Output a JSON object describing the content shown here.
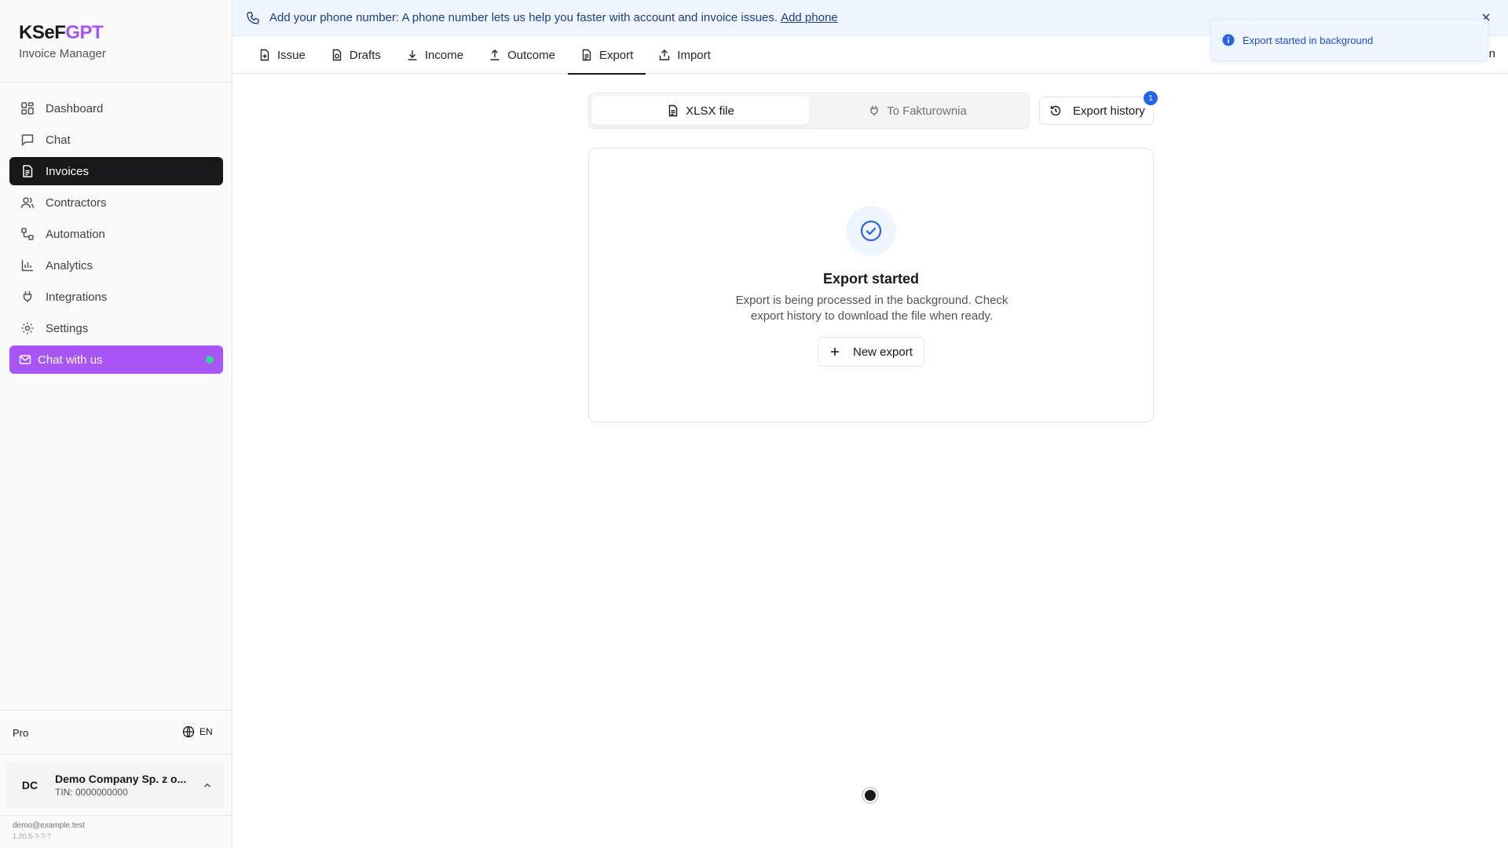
{
  "brand": {
    "name_part1": "KSeF",
    "name_part2": "GPT",
    "subtitle": "Invoice Manager"
  },
  "sidebar": {
    "items": [
      {
        "label": "Dashboard",
        "icon": "dashboard-icon"
      },
      {
        "label": "Chat",
        "icon": "chat-icon"
      },
      {
        "label": "Invoices",
        "icon": "invoice-icon",
        "active": true
      },
      {
        "label": "Contractors",
        "icon": "users-icon"
      },
      {
        "label": "Automation",
        "icon": "workflow-icon"
      },
      {
        "label": "Analytics",
        "icon": "bar-chart-icon"
      },
      {
        "label": "Integrations",
        "icon": "plug-icon"
      },
      {
        "label": "Settings",
        "icon": "gear-icon"
      }
    ],
    "chat_cta": "Chat with us",
    "plan": "Pro",
    "language": "EN",
    "company": {
      "initials": "DC",
      "name": "Demo Company Sp. z o...",
      "tin": "TIN: 0000000000"
    },
    "email": "demo@example.test",
    "version": "1.20.5-?-?-?"
  },
  "banner": {
    "text": "Add your phone number: A phone number lets us help you faster with account and invoice issues.",
    "link": "Add phone",
    "close": "×"
  },
  "tabs": [
    {
      "label": "Issue",
      "icon": "file-plus-icon"
    },
    {
      "label": "Drafts",
      "icon": "draft-icon"
    },
    {
      "label": "Income",
      "icon": "download-icon"
    },
    {
      "label": "Outcome",
      "icon": "upload-icon"
    },
    {
      "label": "Export",
      "icon": "file-text-icon",
      "active": true
    },
    {
      "label": "Import",
      "icon": "import-icon"
    }
  ],
  "tab_overflow_text": "n",
  "toast": {
    "text": "Export started in background"
  },
  "export": {
    "segments": [
      {
        "label": "XLSX file",
        "active": true
      },
      {
        "label": "To Fakturownia",
        "active": false
      }
    ],
    "history_button": "Export history",
    "history_badge": "1",
    "card": {
      "title": "Export started",
      "description": "Export is being processed in the background. Check export history to download the file when ready.",
      "button": "New export"
    }
  },
  "colors": {
    "accent_purple": "#a855f7",
    "info_blue": "#2563eb",
    "banner_bg": "#eff6ff",
    "online_green": "#34d399",
    "active_nav": "#18181b"
  }
}
